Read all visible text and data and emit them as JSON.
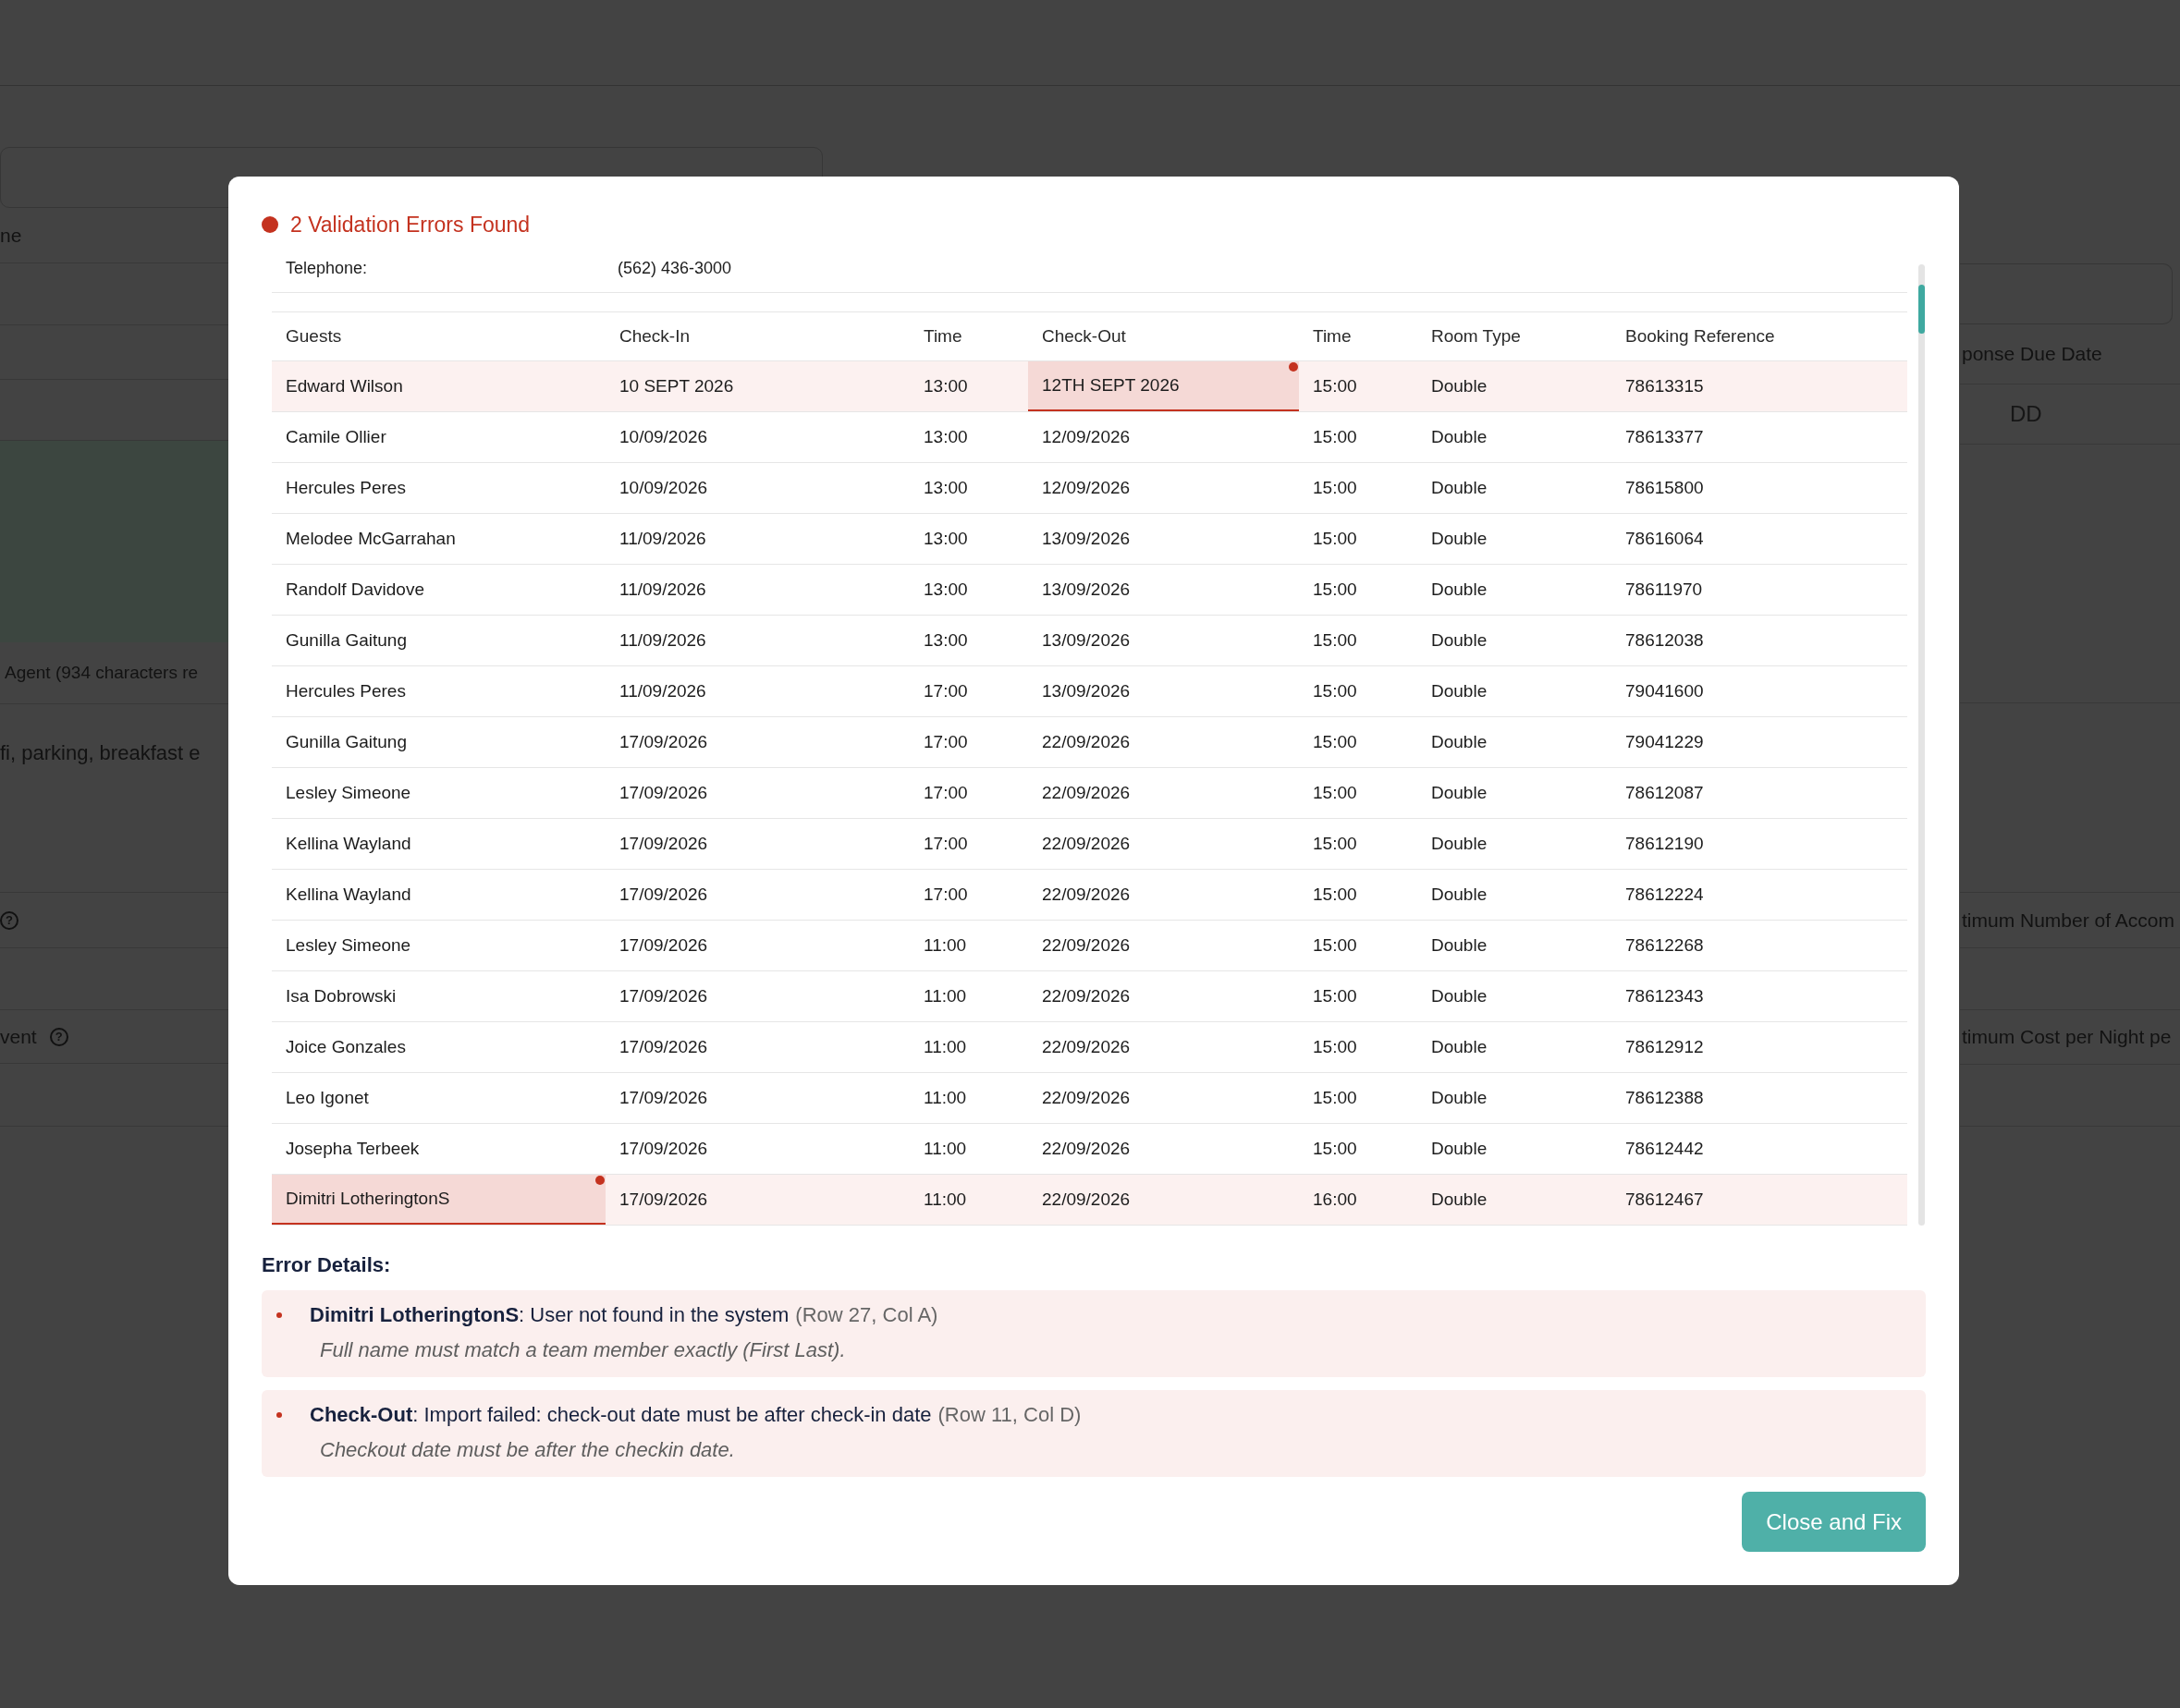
{
  "background": {
    "left": [
      "ne",
      "Agent (934 characters re",
      "fi, parking, breakfast e",
      "vent"
    ],
    "right": [
      "ponse Due Date",
      "timum Number of Accom",
      "timum Cost per Night pe"
    ],
    "date_field": {
      "placeholder": "DD"
    },
    "help_mark": "?"
  },
  "dialog": {
    "title": "2 Validation Errors Found",
    "contact": {
      "label": "Telephone:",
      "value": "(562) 436-3000"
    },
    "table": {
      "columns": [
        "Guests",
        "Check-In",
        "Time",
        "Check-Out",
        "Time",
        "Room Type",
        "Booking Reference"
      ],
      "rows": [
        {
          "flagged": true,
          "error": [
            false,
            false,
            false,
            true,
            false,
            false,
            false
          ],
          "cells": [
            "Edward Wilson",
            "10 SEPT 2026",
            "13:00",
            "12TH SEPT 2026",
            "15:00",
            "Double",
            "78613315"
          ]
        },
        {
          "flagged": false,
          "error": [
            false,
            false,
            false,
            false,
            false,
            false,
            false
          ],
          "cells": [
            "Camile Ollier",
            "10/09/2026",
            "13:00",
            "12/09/2026",
            "15:00",
            "Double",
            "78613377"
          ]
        },
        {
          "flagged": false,
          "error": [
            false,
            false,
            false,
            false,
            false,
            false,
            false
          ],
          "cells": [
            "Hercules Peres",
            "10/09/2026",
            "13:00",
            "12/09/2026",
            "15:00",
            "Double",
            "78615800"
          ]
        },
        {
          "flagged": false,
          "error": [
            false,
            false,
            false,
            false,
            false,
            false,
            false
          ],
          "cells": [
            "Melodee McGarrahan",
            "11/09/2026",
            "13:00",
            "13/09/2026",
            "15:00",
            "Double",
            "78616064"
          ]
        },
        {
          "flagged": false,
          "error": [
            false,
            false,
            false,
            false,
            false,
            false,
            false
          ],
          "cells": [
            "Randolf Davidove",
            "11/09/2026",
            "13:00",
            "13/09/2026",
            "15:00",
            "Double",
            "78611970"
          ]
        },
        {
          "flagged": false,
          "error": [
            false,
            false,
            false,
            false,
            false,
            false,
            false
          ],
          "cells": [
            "Gunilla Gaitung",
            "11/09/2026",
            "13:00",
            "13/09/2026",
            "15:00",
            "Double",
            "78612038"
          ]
        },
        {
          "flagged": false,
          "error": [
            false,
            false,
            false,
            false,
            false,
            false,
            false
          ],
          "cells": [
            "Hercules Peres",
            "11/09/2026",
            "17:00",
            "13/09/2026",
            "15:00",
            "Double",
            "79041600"
          ]
        },
        {
          "flagged": false,
          "error": [
            false,
            false,
            false,
            false,
            false,
            false,
            false
          ],
          "cells": [
            "Gunilla Gaitung",
            "17/09/2026",
            "17:00",
            "22/09/2026",
            "15:00",
            "Double",
            "79041229"
          ]
        },
        {
          "flagged": false,
          "error": [
            false,
            false,
            false,
            false,
            false,
            false,
            false
          ],
          "cells": [
            "Lesley Simeone",
            "17/09/2026",
            "17:00",
            "22/09/2026",
            "15:00",
            "Double",
            "78612087"
          ]
        },
        {
          "flagged": false,
          "error": [
            false,
            false,
            false,
            false,
            false,
            false,
            false
          ],
          "cells": [
            "Kellina Wayland",
            "17/09/2026",
            "17:00",
            "22/09/2026",
            "15:00",
            "Double",
            "78612190"
          ]
        },
        {
          "flagged": false,
          "error": [
            false,
            false,
            false,
            false,
            false,
            false,
            false
          ],
          "cells": [
            "Kellina Wayland",
            "17/09/2026",
            "17:00",
            "22/09/2026",
            "15:00",
            "Double",
            "78612224"
          ]
        },
        {
          "flagged": false,
          "error": [
            false,
            false,
            false,
            false,
            false,
            false,
            false
          ],
          "cells": [
            "Lesley Simeone",
            "17/09/2026",
            "11:00",
            "22/09/2026",
            "15:00",
            "Double",
            "78612268"
          ]
        },
        {
          "flagged": false,
          "error": [
            false,
            false,
            false,
            false,
            false,
            false,
            false
          ],
          "cells": [
            "Isa Dobrowski",
            "17/09/2026",
            "11:00",
            "22/09/2026",
            "15:00",
            "Double",
            "78612343"
          ]
        },
        {
          "flagged": false,
          "error": [
            false,
            false,
            false,
            false,
            false,
            false,
            false
          ],
          "cells": [
            "Joice Gonzales",
            "17/09/2026",
            "11:00",
            "22/09/2026",
            "15:00",
            "Double",
            "78612912"
          ]
        },
        {
          "flagged": false,
          "error": [
            false,
            false,
            false,
            false,
            false,
            false,
            false
          ],
          "cells": [
            "Leo Igonet",
            "17/09/2026",
            "11:00",
            "22/09/2026",
            "15:00",
            "Double",
            "78612388"
          ]
        },
        {
          "flagged": false,
          "error": [
            false,
            false,
            false,
            false,
            false,
            false,
            false
          ],
          "cells": [
            "Josepha Terbeek",
            "17/09/2026",
            "11:00",
            "22/09/2026",
            "15:00",
            "Double",
            "78612442"
          ]
        },
        {
          "flagged": true,
          "error": [
            true,
            false,
            false,
            false,
            false,
            false,
            false
          ],
          "cells": [
            "Dimitri LotheringtonS",
            "17/09/2026",
            "11:00",
            "22/09/2026",
            "16:00",
            "Double",
            "78612467"
          ]
        }
      ]
    },
    "errors_heading": "Error Details:",
    "errors": [
      {
        "message": "**Dimitri LotheringtonS**: User not found in the system",
        "location": "(Row 27, Col A)",
        "hint": "Full name must match a team member exactly (First Last)."
      },
      {
        "message": "**Check-Out**: Import failed: check-out date must be after check-in date",
        "location": "(Row 11, Col D)",
        "hint": "Checkout date must be after the checkin date."
      }
    ],
    "button": "Close and Fix"
  }
}
